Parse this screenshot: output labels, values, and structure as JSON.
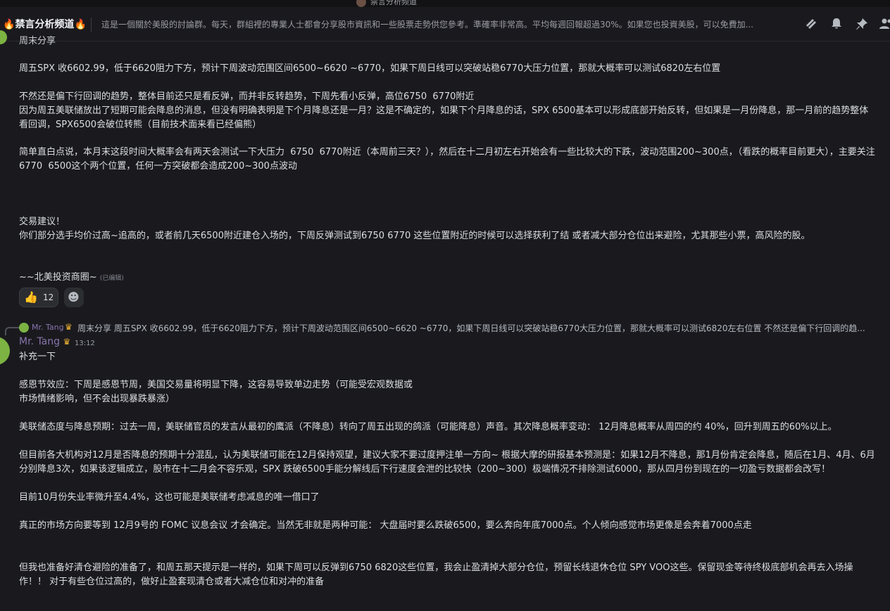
{
  "window": {
    "title": "禁言分析频道"
  },
  "header": {
    "channel_name": "禁言分析频道",
    "topic": "這是一個關於美股的討論群。每天，群組裡的專業人士都會分享股市資訊和一些股票走勢供您參考。準確率非常高。平均每週回報超過30%。如果您也投資美股，可以免費加...",
    "icons": [
      "threads-icon",
      "bell-icon",
      "pin-icon",
      "members-icon"
    ]
  },
  "message1": {
    "header_fragment": "周末分享",
    "lines": [
      "周五SPX 收6602.99，低于6620阻力下方，预计下周波动范围区间6500~6620 ~6770，如果下周日线可以突破站稳6770大压力位置，那就大概率可以测试6820左右位置",
      "",
      "不然还是偏下行回调的趋势，整体目前还只是看反弹，而并非反转趋势，下周先看小反弹，高位6750  6770附近",
      "因为周五美联储放出了短期可能会降息的消息，但没有明确表明是下个月降息还是一月？这是不确定的，如果下个月降息的话，SPX 6500基本可以形成底部开始反转，但如果是一月份降息，那一月前的趋势整体看回调，SPX6500会破位转熊（目前技术面来看已经偏熊）",
      "",
      "简单直白点说，本月末这段时间大概率会有两天会测试一下大压力  6750  6770附近（本周前三天？），然后在十二月初左右开始会有一些比较大的下跌，波动范围200~300点，（看跌的概率目前更大），主要关注6770  6500这个两个位置，任何一方突破都会造成200~300点波动",
      "",
      "",
      "",
      "交易建议！",
      "你们部分选手均价过高~追高的，或者前几天6500附近建仓入场的，下周反弹测试到6750 6770 这些位置附近的时候可以选择获利了结 或者减大部分仓位出来避险，尤其那些小票，高风险的股。",
      "",
      "~~北美投资商圈~"
    ],
    "edited_label": "(已编辑)",
    "reaction": {
      "emoji": "👍",
      "count": "12"
    },
    "add_reaction_icon": "☻"
  },
  "reply": {
    "author": "Mr. Tang",
    "crown": "♛",
    "preview": "周末分享 周五SPX 收6602.99，低于6620阻力下方，预计下周波动范围区间6500~6620 ~6770，如果下周日线可以突破站稳6770大压力位置，那就大概率可以测试6820左右位置 不然还是偏下行回调的趋..."
  },
  "message2": {
    "author": "Mr. Tang",
    "crown": "♛",
    "timestamp": "13:12",
    "text": "补充一下\n\n感恩节效应：下周是感恩节周，美国交易量将明显下降，这容易导致单边走势（可能受宏观数据或\n市场情绪影响，但不会出现暴跌暴涨）\n\n美联储态度与降息预期：过去一周，美联储官员的发言从最初的鹰派（不降息）转向了周五出现的鸽派（可能降息）声音。其次降息概率变动： 12月降息概率从周四的约 40%，回升到周五的60%以上。\n\n但目前各大机构对12月是否降息的预期十分混乱，认为美联储可能在12月保持观望，建议大家不要过度押注单一方向~ 根据大摩的研报基本预测是：如果12月不降息，那1月份肯定会降息，随后在1月、4月、6月分别降息3次，如果该逻辑成立，股市在十二月会不容乐观，SPX 跌破6500手能分解线后下行速度会泄的比较快（200~300）极端情况不排除测试6000，那从四月份到现在的一切盈亏数据都会改写！\n\n目前10月份失业率微升至4.4%，这也可能是美联储考虑减息的唯一借口了\n\n真正的市场方向要等到 12月9号的 FOMC 议息会议 才会确定。当然无非就是两种可能： 大盘届时要么跌破6500，要么奔向年底7000点。个人倾向感觉市场更像是会奔着7000点走\n\n\n但我也准备好清仓避险的准备了，和周五那天提示是一样的，如果下周可以反弹到6750 6820这些位置，我会止盈清掉大部分仓位，预留长线退休仓位 SPY VOO这些。保留现金等待终极底部机会再去入场操作！！ 对于有些仓位过高的，做好止盈套现清仓或者大减仓位和对冲的准备"
  }
}
